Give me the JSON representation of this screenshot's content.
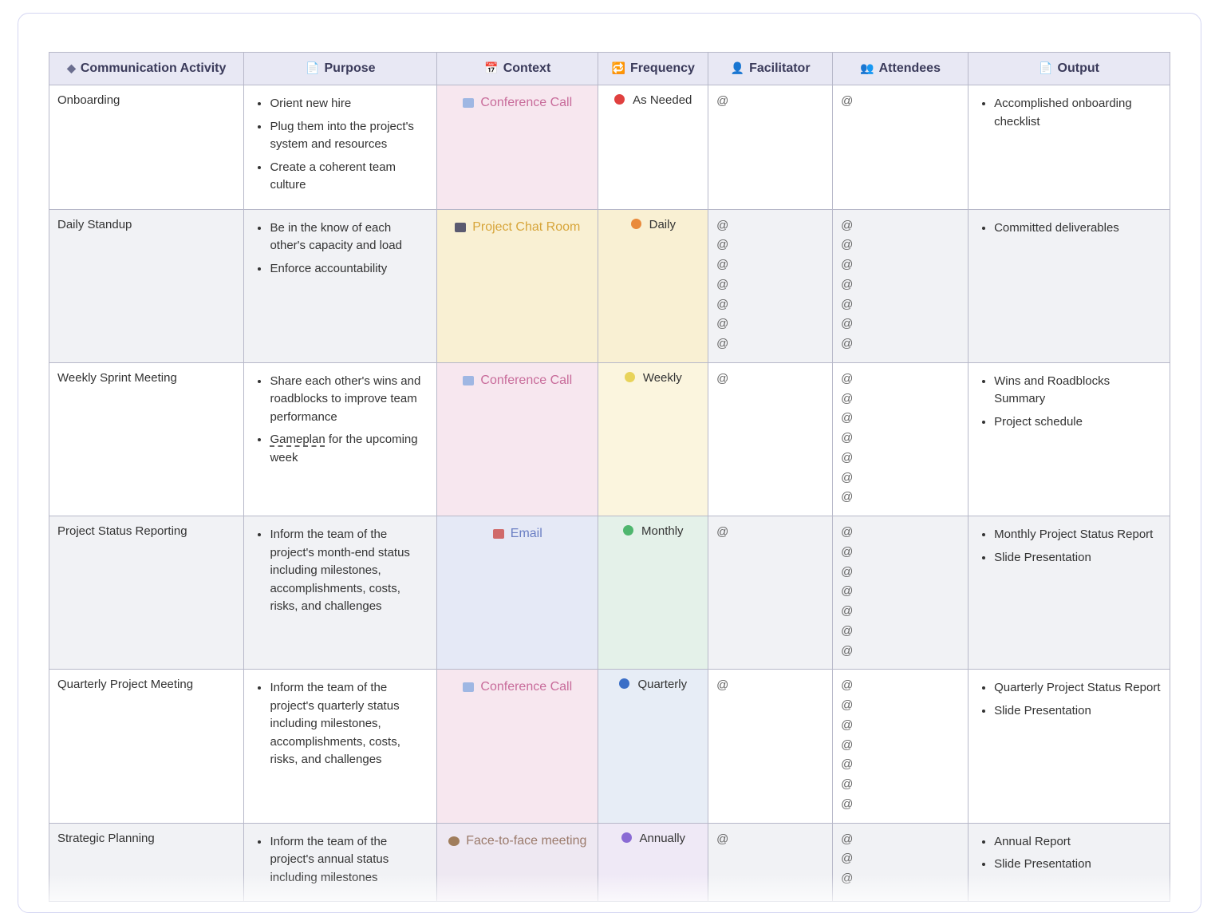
{
  "mention_glyph": "@",
  "columns": [
    {
      "icon": "◆",
      "label": "Communication Activity",
      "name": "col-activity"
    },
    {
      "icon": "📄",
      "label": "Purpose",
      "name": "col-purpose"
    },
    {
      "icon": "📅",
      "label": "Context",
      "name": "col-context"
    },
    {
      "icon": "🔁",
      "label": "Frequency",
      "name": "col-frequency"
    },
    {
      "icon": "👤",
      "label": "Facilitator",
      "name": "col-facilitator"
    },
    {
      "icon": "👥",
      "label": "Attendees",
      "name": "col-attendees"
    },
    {
      "icon": "📄",
      "label": "Output",
      "name": "col-output"
    }
  ],
  "context_types": {
    "conf": {
      "label": "Conference Call"
    },
    "chat": {
      "label": "Project Chat Room"
    },
    "email": {
      "label": "Email"
    },
    "f2f": {
      "label": "Face-to-face meeting"
    }
  },
  "frequency_types": {
    "asneeded": {
      "label": "As Needed"
    },
    "daily": {
      "label": "Daily"
    },
    "weekly": {
      "label": "Weekly"
    },
    "monthly": {
      "label": "Monthly"
    },
    "quarterly": {
      "label": "Quarterly"
    },
    "annually": {
      "label": "Annually"
    }
  },
  "rows": [
    {
      "activity": "Onboarding",
      "purpose": [
        "Orient new hire",
        "Plug them into the project's system and resources",
        "Create a coherent team culture"
      ],
      "context": "conf",
      "frequency": "asneeded",
      "facilitator_count": 1,
      "attendee_count": 1,
      "output": [
        "Accomplished onboarding checklist"
      ]
    },
    {
      "activity": "Daily Standup",
      "purpose": [
        "Be in the know of each other's capacity and load",
        "Enforce accountability"
      ],
      "context": "chat",
      "frequency": "daily",
      "facilitator_count": 7,
      "attendee_count": 7,
      "output": [
        "Committed deliverables"
      ]
    },
    {
      "activity": "Weekly Sprint Meeting",
      "purpose": [
        "Share each other's wins and roadblocks to improve team performance",
        {
          "underline": "Gameplan",
          "rest": " for the upcoming week"
        }
      ],
      "context": "conf",
      "frequency": "weekly",
      "facilitator_count": 1,
      "attendee_count": 7,
      "output": [
        "Wins and Roadblocks Summary",
        "Project schedule"
      ]
    },
    {
      "activity": "Project Status Reporting",
      "purpose": [
        "Inform the team of the project's month-end status including milestones, accomplishments, costs, risks, and challenges"
      ],
      "context": "email",
      "frequency": "monthly",
      "facilitator_count": 1,
      "attendee_count": 7,
      "output": [
        "Monthly Project Status Report",
        "Slide Presentation"
      ]
    },
    {
      "activity": "Quarterly Project Meeting",
      "purpose": [
        "Inform the team of the project's quarterly status including milestones, accomplishments, costs, risks, and challenges"
      ],
      "context": "conf",
      "frequency": "quarterly",
      "facilitator_count": 1,
      "attendee_count": 7,
      "output": [
        "Quarterly Project Status Report",
        "Slide Presentation"
      ]
    },
    {
      "activity": "Strategic Planning",
      "purpose": [
        "Inform the team of the project's annual status including milestones"
      ],
      "context": "f2f",
      "frequency": "annually",
      "facilitator_count": 1,
      "attendee_count": 3,
      "output": [
        "Annual Report",
        "Slide Presentation"
      ]
    }
  ]
}
